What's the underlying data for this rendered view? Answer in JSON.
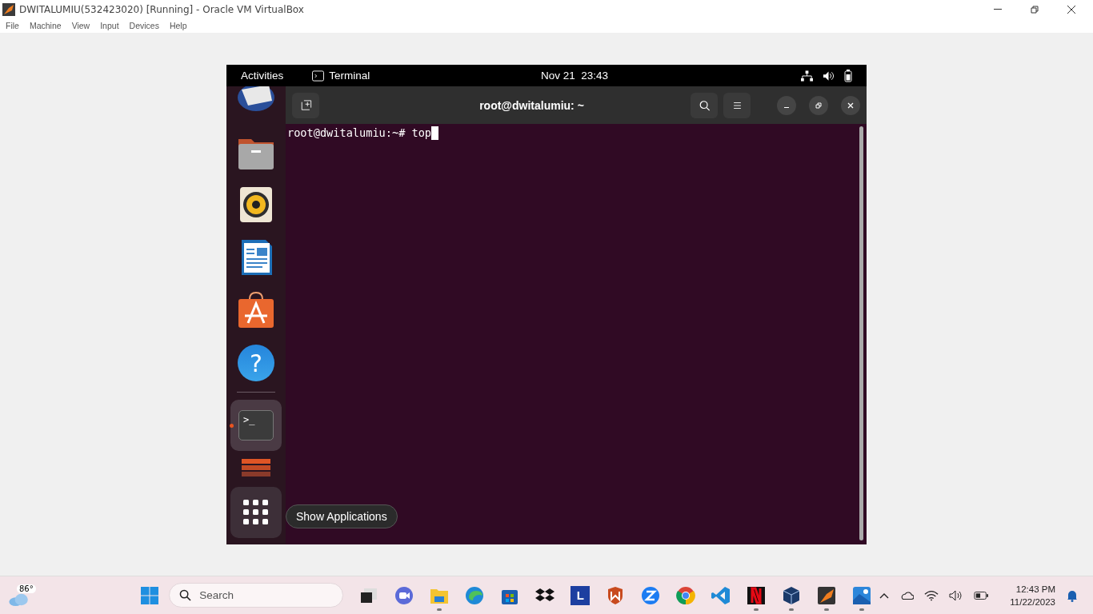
{
  "vbox": {
    "title": "DWITALUMIU(532423020) [Running] - Oracle VM VirtualBox",
    "menu": [
      "File",
      "Machine",
      "View",
      "Input",
      "Devices",
      "Help"
    ]
  },
  "gnome": {
    "activities": "Activities",
    "app": "Terminal",
    "clock": "Nov 21  23:43"
  },
  "terminal": {
    "title": "root@dwitalumiu: ~",
    "prompt": "root@dwitalumiu:~# ",
    "command": "top"
  },
  "dock": [
    {
      "kind": "mail",
      "active": false
    },
    {
      "kind": "folder",
      "active": false
    },
    {
      "kind": "speaker",
      "active": false
    },
    {
      "kind": "document",
      "active": false
    },
    {
      "kind": "store",
      "active": false
    },
    {
      "kind": "help",
      "glyph": "?",
      "active": false
    },
    {
      "kind": "terminal",
      "glyph": ">_",
      "active": true
    },
    {
      "kind": "partial",
      "active": false
    }
  ],
  "tooltip": "Show Applications",
  "taskbar": {
    "weather": "86°",
    "search": "Search",
    "apps": [
      {
        "kind": "windows",
        "running": false
      },
      {
        "kind": "taskview",
        "running": false
      },
      {
        "kind": "meet",
        "running": false
      },
      {
        "kind": "folder",
        "running": true
      },
      {
        "kind": "edge",
        "running": false
      },
      {
        "kind": "store",
        "running": false
      },
      {
        "kind": "dropbox",
        "running": false
      },
      {
        "kind": "letter",
        "glyph": "L",
        "running": false
      },
      {
        "kind": "shield",
        "running": false
      },
      {
        "kind": "zoom",
        "running": false
      },
      {
        "kind": "chrome",
        "running": false
      },
      {
        "kind": "vscode",
        "running": false
      },
      {
        "kind": "netflix",
        "running": true
      },
      {
        "kind": "cube",
        "running": true
      },
      {
        "kind": "g4",
        "running": true
      },
      {
        "kind": "photos",
        "running": true
      }
    ],
    "time": "12:43 PM",
    "date": "11/22/2023"
  }
}
